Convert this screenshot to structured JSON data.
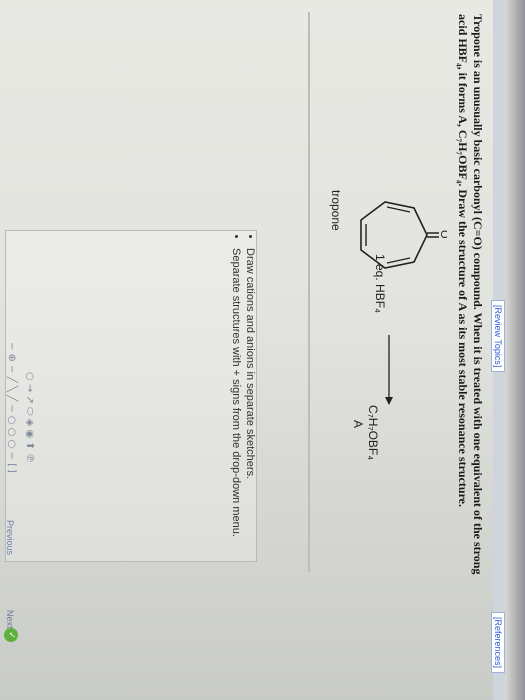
{
  "header": {
    "review_topics": "[Review Topics]",
    "references": "[References]"
  },
  "question": {
    "line1": "Tropone is an unusually basic carbonyl (C=O) compound. When it is treated with one equivalent of the strong",
    "line2": "acid HBF₄, it forms A, C₇H₇OBF₄. Draw the structure of A as its most stable resonance structure."
  },
  "reaction": {
    "reactant_name": "tropone",
    "carbonyl_atom": "O",
    "reagent": "1 eq. HBF₄",
    "product_formula": "C₇H₇OBF₄",
    "product_label": "A"
  },
  "instructions": [
    "Draw cations and anions in separate sketchers.",
    "Separate structures with + signs from the drop-down menu."
  ],
  "sketcher": {
    "toolbar_row1": "○ → ↗ ⬭  ◈ ◉ ⬆ ℗",
    "toolbar_row2": "− ⊕ − ╱ ╲ ╱ −  ○ ○ ○ − [ ]",
    "check_glyph": "✓"
  },
  "navigation": {
    "previous": "Previous",
    "next": "Next"
  }
}
